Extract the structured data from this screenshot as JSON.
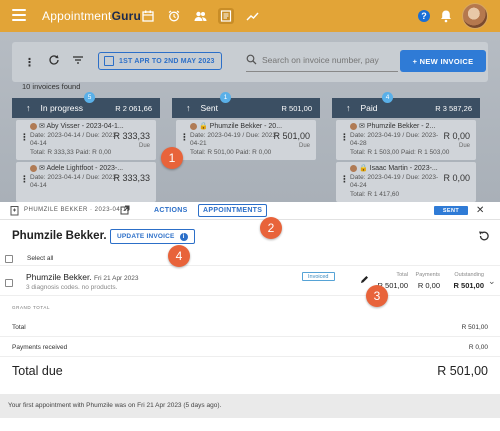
{
  "app": {
    "brand_part1": "Appointment",
    "brand_part2": "Guru",
    "nav_icons": [
      "calendar-icon",
      "alarm-icon",
      "people-icon",
      "invoice-icon",
      "trend-icon"
    ],
    "help_label": "?",
    "colors": {
      "appbar": "#e2a437",
      "accent": "#2f7bd6",
      "marker": "#e8633a",
      "column_header": "#3b4f63"
    }
  },
  "toolbar": {
    "date_range": "1ST APR TO 2ND MAY 2023",
    "search_placeholder": "Search on invoice number, pay",
    "new_invoice_label": "+ NEW INVOICE",
    "invoices_found": "10 invoices found"
  },
  "columns": [
    {
      "name": "In progress",
      "badge": "5",
      "amount": "R 2 061,66",
      "cards": [
        {
          "person": "Aby Visser - 2023-04-1...",
          "dates": "Date: 2023-04-14 / Due: 2023-",
          "dates2": "04-14",
          "totals": "Total: R 333,33     Paid: R 0,00",
          "value": "R 333,33",
          "due": "Due"
        },
        {
          "person": "Adele Lightfoot - 2023-...",
          "dates": "Date: 2023-04-14 / Due: 2023-",
          "dates2": "04-14",
          "totals": "",
          "value": "R 333,33",
          "due": ""
        }
      ]
    },
    {
      "name": "Sent",
      "badge": "1",
      "amount": "R 501,00",
      "cards": [
        {
          "person": "Phumzile Bekker - 20...",
          "dates": "Date: 2023-04-19 / Due: 2023-",
          "dates2": "04-21",
          "totals": "Total: R 501,00     Paid: R 0,00",
          "value": "R 501,00",
          "due": "Due"
        }
      ]
    },
    {
      "name": "Paid",
      "badge": "4",
      "amount": "R 3 587,26",
      "cards": [
        {
          "person": "Phumzile Bekker - 2...",
          "dates": "Date: 2023-04-19 / Due: 2023-",
          "dates2": "04-28",
          "totals": "Total: R 1 503,00     Paid: R 1 503,00",
          "value": "R 0,00",
          "due": "Due"
        },
        {
          "person": "Isaac Martin - 2023-...",
          "dates": "Date: 2023-04-19 / Due: 2023-",
          "dates2": "04-24",
          "totals": "Total: R 1 417,60",
          "value": "R 0,00",
          "due": ""
        }
      ]
    }
  ],
  "panel": {
    "title": "PHUMZILE BEKKER · 2023-04-19",
    "tab_actions": "ACTIONS",
    "tab_appointments": "APPOINTMENTS",
    "status_badge": "SENT",
    "patient_name": "Phumzile Bekker.",
    "update_invoice_label": "UPDATE INVOICE",
    "select_all": "Select all",
    "appointment": {
      "name": "Phumzile Bekker.",
      "date": "Fri 21 Apr 2023",
      "summary": "3 diagnosis codes. no products.",
      "status": "Invoiced",
      "total_label": "Total",
      "total": "R 501,00",
      "payments_label": "Payments",
      "payments": "R 0,00",
      "outstanding_label": "Outstanding",
      "outstanding": "R 501,00"
    },
    "grand_total_label": "GRAND TOTAL",
    "total_label": "Total",
    "total_value": "R 501,00",
    "payments_label": "Payments received",
    "payments_value": "R 0,00",
    "total_due_label": "Total due",
    "total_due_value": "R 501,00",
    "footer_text": "Your first appointment with Phumzile was on Fri 21 Apr 2023 (5 days ago)."
  },
  "markers": [
    "1",
    "2",
    "3",
    "4"
  ]
}
